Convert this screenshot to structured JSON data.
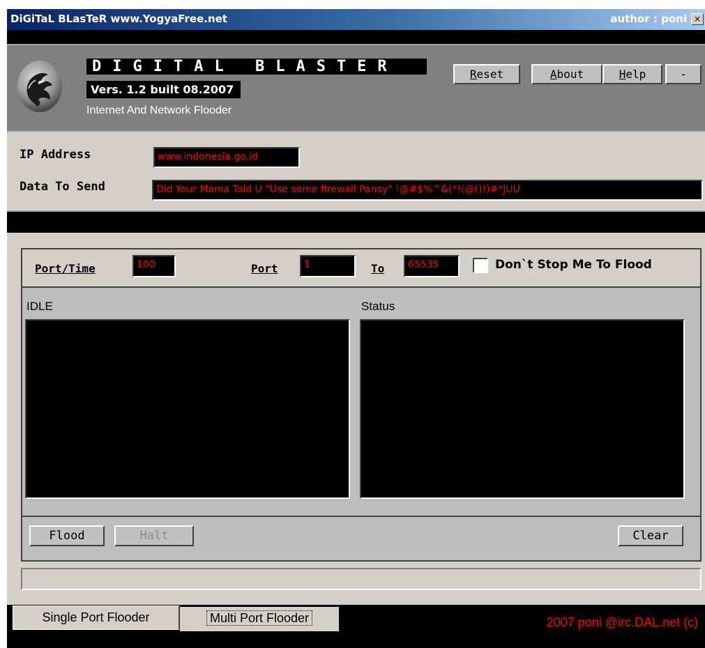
{
  "window": {
    "title": "DiGiTaL BLasTeR  www.YogyaFree.net",
    "author": "author : poni",
    "close_glyph": "×"
  },
  "header": {
    "brand": "DIGITAL BLASTER",
    "version": "Vers. 1.2 built 08.2007",
    "subtitle": "Internet And Network Flooder",
    "buttons": {
      "reset": {
        "ul": "R",
        "rest": "eset"
      },
      "about": {
        "ul": "A",
        "rest": "bout"
      },
      "help": {
        "ul": "H",
        "rest": "elp"
      },
      "minimize": "-"
    }
  },
  "inputs": {
    "ip_label": "IP Address",
    "ip_value": "www.indonesia.go.id",
    "data_label": "Data To Send",
    "data_value": "Did Your Mama Told U \"Use some firewall Pansy\" !@#$%^&(*!(@()!)#*JUU"
  },
  "flood_panel": {
    "port_time_label": "Port/Time",
    "port_time_value": "100",
    "port_label": "Port",
    "port_from_value": "1",
    "to_label": "To",
    "port_to_value": "65535",
    "dont_stop_label": "Don`t Stop Me To Flood",
    "dont_stop_checked": false,
    "idle_label": "IDLE",
    "status_label": "Status",
    "flood_button": "Flood",
    "halt_button": "Halt",
    "clear_button": "Clear"
  },
  "tabs": [
    {
      "label": "Single Port Flooder",
      "active": true
    },
    {
      "label": "Multi Port Flooder",
      "active": false
    }
  ],
  "footer": {
    "copyright": "2007  poni @irc.DAL.net (c)"
  },
  "colors": {
    "field_text": "#ff0000",
    "field_bg": "#000000",
    "title_gradient_start": "#0a246a",
    "panel_gray": "#d4d0c8",
    "header_gray": "#808080"
  },
  "icons": {
    "logo": "dragon-logo-icon",
    "close": "close-icon"
  }
}
